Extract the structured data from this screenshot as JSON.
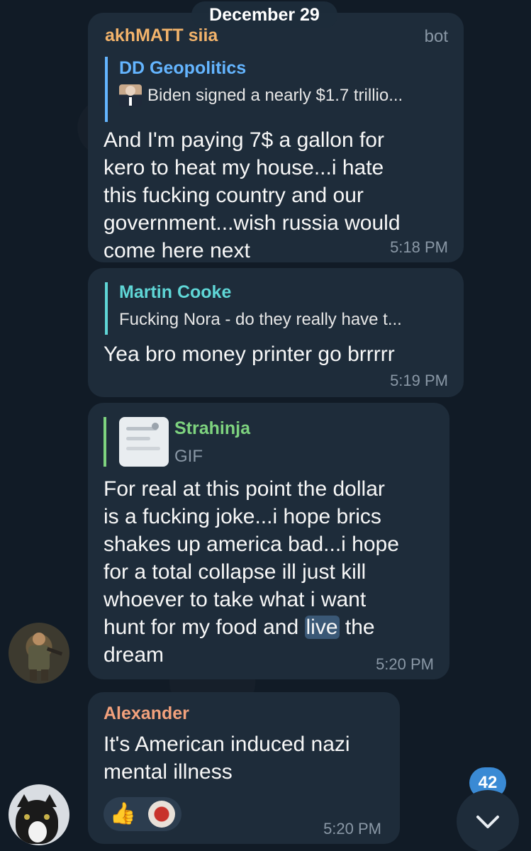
{
  "date_label": "December 29",
  "colors": {
    "background": "#111b26",
    "bubble": "#1e2c3a",
    "time": "#8a98a6",
    "sender_akh": "#f2b36b",
    "reply_dd": "#64b5ff",
    "reply_martin": "#5fd6d6",
    "reply_strahinja": "#7ed37f",
    "sender_alexander": "#f2a17c",
    "badge": "#3a8ad4"
  },
  "messages": [
    {
      "sender": "akhMATT siia",
      "tag": "bot",
      "reply": {
        "name": "DD Geopolitics",
        "text": "Biden signed a nearly $1.7 trillio...",
        "thumb": "biden-photo-icon"
      },
      "text_lines": [
        "And I'm paying 7$ a gallon for",
        "kero to heat my house...i hate",
        "this fucking country and our",
        "government...wish russia would",
        "come here next"
      ],
      "time": "5:18 PM"
    },
    {
      "reply": {
        "name": "Martin Cooke",
        "text": "Fucking Nora - do they really have t..."
      },
      "text_lines": [
        "Yea bro money printer go brrrrr"
      ],
      "time": "5:19 PM"
    },
    {
      "reply": {
        "name": "Strahinja",
        "text": "GIF",
        "thumb": "gif-thumbnail-icon"
      },
      "text_lines": [
        "For real at this point the dollar",
        "is a fucking joke...i hope brics",
        "shakes up america bad...i hope",
        "for a total collapse ill just kill",
        "whoever to take what i want"
      ],
      "line6_before": "hunt for my food and ",
      "line6_highlight": "live",
      "line6_after": " the",
      "line7": "dream",
      "time": "5:20 PM"
    },
    {
      "sender": "Alexander",
      "text_lines": [
        "It's American induced nazi",
        "mental illness"
      ],
      "reactions": [
        "thumbs-up-emoji",
        "sticker-reaction-icon"
      ],
      "time": "5:20 PM"
    }
  ],
  "unread_badge": "42",
  "scroll_icon": "chevron-down-icon"
}
